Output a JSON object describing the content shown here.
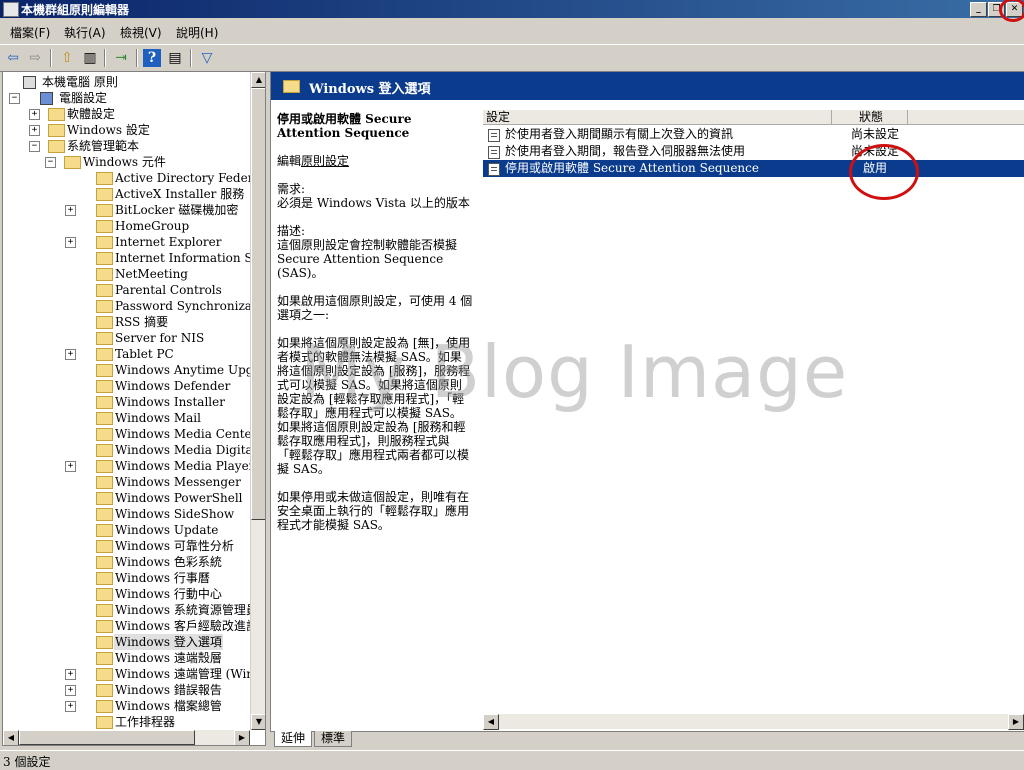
{
  "window": {
    "title": "本機群組原則編輯器",
    "buttons": [
      "_",
      "❐",
      "✕"
    ]
  },
  "menubar": [
    "檔案(F)",
    "執行(A)",
    "檢視(V)",
    "說明(H)"
  ],
  "toolbar": [
    {
      "icon": "back-icon",
      "glyph": "⇦"
    },
    {
      "icon": "forward-icon",
      "glyph": "⇨"
    },
    {
      "icon": "up-folder-icon",
      "glyph": "⇧"
    },
    {
      "icon": "show-hide-tree-icon",
      "glyph": "▥"
    },
    {
      "icon": "export-list-icon",
      "glyph": "⇥"
    },
    {
      "icon": "help-icon",
      "glyph": "?"
    },
    {
      "icon": "properties-icon",
      "glyph": "▤"
    },
    {
      "icon": "filter-icon",
      "glyph": "▽"
    }
  ],
  "tree": [
    {
      "label": "本機電腦 原則",
      "level": 0,
      "expander": "",
      "icon": "policy"
    },
    {
      "label": "電腦設定",
      "level": 1,
      "expander": "−",
      "icon": "computer"
    },
    {
      "label": "軟體設定",
      "level": 2,
      "expander": "+",
      "icon": "folder"
    },
    {
      "label": "Windows 設定",
      "level": 2,
      "expander": "+",
      "icon": "folder"
    },
    {
      "label": "系統管理範本",
      "level": 2,
      "expander": "−",
      "icon": "folder"
    },
    {
      "label": "Windows 元件",
      "level": 3,
      "expander": "−",
      "icon": "folder"
    },
    {
      "label": "Active Directory Federation Ser",
      "level": 4,
      "expander": "",
      "icon": "folder"
    },
    {
      "label": "ActiveX Installer 服務",
      "level": 4,
      "expander": "",
      "icon": "folder"
    },
    {
      "label": "BitLocker 磁碟機加密",
      "level": 4,
      "expander": "+",
      "icon": "folder"
    },
    {
      "label": "HomeGroup",
      "level": 4,
      "expander": "",
      "icon": "folder"
    },
    {
      "label": "Internet Explorer",
      "level": 4,
      "expander": "+",
      "icon": "folder"
    },
    {
      "label": "Internet Information Services",
      "level": 4,
      "expander": "",
      "icon": "folder"
    },
    {
      "label": "NetMeeting",
      "level": 4,
      "expander": "",
      "icon": "folder"
    },
    {
      "label": "Parental Controls",
      "level": 4,
      "expander": "",
      "icon": "folder"
    },
    {
      "label": "Password Synchronization",
      "level": 4,
      "expander": "",
      "icon": "folder"
    },
    {
      "label": "RSS 摘要",
      "level": 4,
      "expander": "",
      "icon": "folder"
    },
    {
      "label": "Server for NIS",
      "level": 4,
      "expander": "",
      "icon": "folder"
    },
    {
      "label": "Tablet PC",
      "level": 4,
      "expander": "+",
      "icon": "folder"
    },
    {
      "label": "Windows Anytime Upgrade",
      "level": 4,
      "expander": "",
      "icon": "folder"
    },
    {
      "label": "Windows Defender",
      "level": 4,
      "expander": "",
      "icon": "folder"
    },
    {
      "label": "Windows Installer",
      "level": 4,
      "expander": "",
      "icon": "folder"
    },
    {
      "label": "Windows Mail",
      "level": 4,
      "expander": "",
      "icon": "folder"
    },
    {
      "label": "Windows Media Center",
      "level": 4,
      "expander": "",
      "icon": "folder"
    },
    {
      "label": "Windows Media Digital Rights",
      "level": 4,
      "expander": "",
      "icon": "folder"
    },
    {
      "label": "Windows Media Player",
      "level": 4,
      "expander": "+",
      "icon": "folder"
    },
    {
      "label": "Windows Messenger",
      "level": 4,
      "expander": "",
      "icon": "folder"
    },
    {
      "label": "Windows PowerShell",
      "level": 4,
      "expander": "",
      "icon": "folder"
    },
    {
      "label": "Windows SideShow",
      "level": 4,
      "expander": "",
      "icon": "folder"
    },
    {
      "label": "Windows Update",
      "level": 4,
      "expander": "",
      "icon": "folder"
    },
    {
      "label": "Windows 可靠性分析",
      "level": 4,
      "expander": "",
      "icon": "folder"
    },
    {
      "label": "Windows 色彩系統",
      "level": 4,
      "expander": "",
      "icon": "folder"
    },
    {
      "label": "Windows 行事曆",
      "level": 4,
      "expander": "",
      "icon": "folder"
    },
    {
      "label": "Windows 行動中心",
      "level": 4,
      "expander": "",
      "icon": "folder"
    },
    {
      "label": "Windows 系統資源管理員",
      "level": 4,
      "expander": "",
      "icon": "folder"
    },
    {
      "label": "Windows 客戶經驗改進計畫",
      "level": 4,
      "expander": "",
      "icon": "folder"
    },
    {
      "label": "Windows 登入選項",
      "level": 4,
      "expander": "",
      "icon": "folder",
      "selected": true
    },
    {
      "label": "Windows 遠端殼層",
      "level": 4,
      "expander": "",
      "icon": "folder"
    },
    {
      "label": "Windows 遠端管理 (WinRM)",
      "level": 4,
      "expander": "+",
      "icon": "folder"
    },
    {
      "label": "Windows 錯誤報告",
      "level": 4,
      "expander": "+",
      "icon": "folder"
    },
    {
      "label": "Windows 檔案總管",
      "level": 4,
      "expander": "+",
      "icon": "folder"
    },
    {
      "label": "工作排程器",
      "level": 4,
      "expander": "",
      "icon": "folder"
    }
  ],
  "right_header": "Windows 登入選項",
  "description": {
    "title": "停用或啟用軟體 Secure Attention Sequence",
    "edit_prefix": "編輯",
    "edit_link": "原則設定",
    "requirement_label": "需求:",
    "requirement": "必須是 Windows Vista 以上的版本",
    "desc_label": "描述:",
    "desc": "這個原則設定會控制軟體能否模擬 Secure Attention Sequence (SAS)。",
    "para1": "如果啟用這個原則設定，可使用 4 個選項之一:",
    "para2": "如果將這個原則設定設為 [無]，使用者模式的軟體無法模擬 SAS。如果將這個原則設定設為 [服務]，服務程式可以模擬 SAS。如果將這個原則設定設為 [輕鬆存取應用程式]，「輕鬆存取」應用程式可以模擬 SAS。如果將這個原則設定設為 [服務和輕鬆存取應用程式]，則服務程式與「輕鬆存取」應用程式兩者都可以模擬 SAS。",
    "para3": "如果停用或未做這個設定，則唯有在安全桌面上執行的「輕鬆存取」應用程式才能模擬 SAS。"
  },
  "list": {
    "columns": [
      "設定",
      "狀態"
    ],
    "rows": [
      {
        "setting": "於使用者登入期間顯示有關上次登入的資訊",
        "status": "尚未設定"
      },
      {
        "setting": "於使用者登入期間，報告登入伺服器無法使用",
        "status": "尚未設定"
      },
      {
        "setting": "停用或啟用軟體 Secure Attention Sequence",
        "status": "啟用",
        "selected": true
      }
    ]
  },
  "tabs": [
    "延伸",
    "標準"
  ],
  "status_bar": "3 個設定",
  "watermark": "My Blog Image",
  "colors": {
    "title_blue": "#0a246a",
    "header_blue": "#0a3b8c",
    "annotation_red": "#d01010"
  }
}
